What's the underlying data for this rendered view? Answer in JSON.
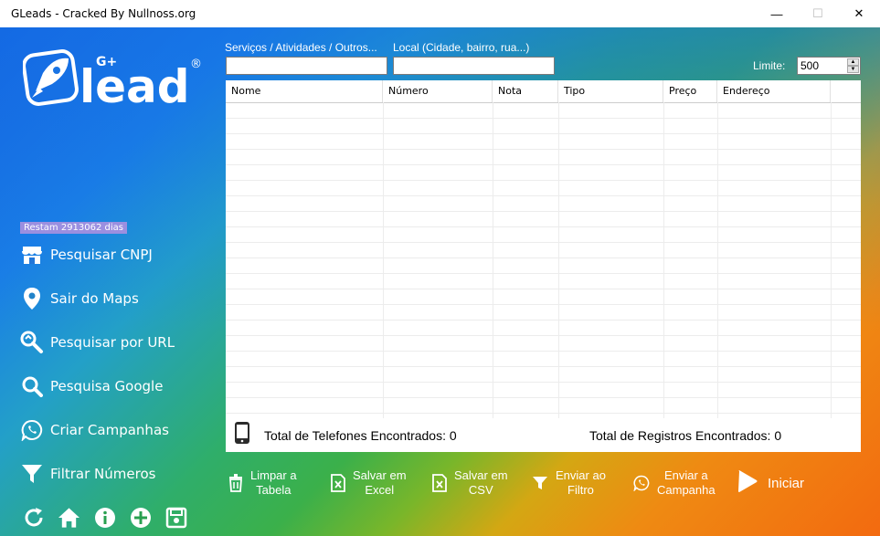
{
  "window": {
    "title": "GLeads - Cracked By Nullnoss.org",
    "min": "—",
    "max": "☐",
    "close": "✕"
  },
  "logo": {
    "text": "lead",
    "plus": "G+",
    "reg": "®"
  },
  "sidebar": {
    "badge": "Restam 2913062 dias",
    "items": [
      {
        "label": "Pesquisar CNPJ",
        "icon": "store-icon"
      },
      {
        "label": "Sair do Maps",
        "icon": "map-pin-icon"
      },
      {
        "label": "Pesquisar por URL",
        "icon": "search-link-icon"
      },
      {
        "label": "Pesquisa Google",
        "icon": "search-icon"
      },
      {
        "label": "Criar Campanhas",
        "icon": "whatsapp-icon"
      },
      {
        "label": "Filtrar Números",
        "icon": "filter-icon"
      }
    ],
    "bottom_icons": [
      "refresh-icon",
      "home-icon",
      "info-icon",
      "add-icon",
      "save-icon"
    ]
  },
  "search": {
    "services_label": "Serviços / Atividades / Outros...",
    "services_value": "",
    "location_label": "Local (Cidade, bairro, rua...)",
    "location_value": "",
    "limit_label": "Limite:",
    "limit_value": "500"
  },
  "table": {
    "columns": [
      "Nome",
      "Número",
      "Nota",
      "Tipo",
      "Preço",
      "Endereço"
    ],
    "rows": []
  },
  "footer": {
    "phones_total": "Total de Telefones Encontrados: 0",
    "records_total": "Total de Registros Encontrados: 0"
  },
  "actions": [
    {
      "label1": "Limpar a",
      "label2": "Tabela",
      "icon": "trash-icon"
    },
    {
      "label1": "Salvar em",
      "label2": "Excel",
      "icon": "excel-icon"
    },
    {
      "label1": "Salvar em",
      "label2": "CSV",
      "icon": "csv-icon"
    },
    {
      "label1": "Enviar ao",
      "label2": "Filtro",
      "icon": "filter-icon"
    },
    {
      "label1": "Enviar a",
      "label2": "Campanha",
      "icon": "whatsapp-icon"
    }
  ],
  "start_label": "Iniciar",
  "colors": {
    "gradient_start": "#1565e0",
    "gradient_mid": "#3bb04a",
    "gradient_end": "#f36a10",
    "badge": "#9b8fe0"
  }
}
